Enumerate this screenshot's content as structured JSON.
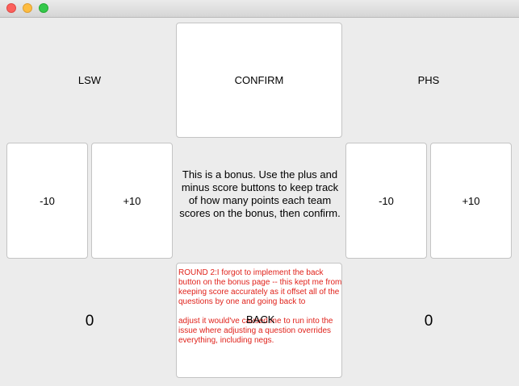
{
  "teams": {
    "left": {
      "name": "LSW",
      "score": "0",
      "minus_label": "-10",
      "plus_label": "+10"
    },
    "right": {
      "name": "PHS",
      "score": "0",
      "minus_label": "-10",
      "plus_label": "+10"
    }
  },
  "confirm_label": "CONFIRM",
  "description": "This is a bonus. Use the plus and minus score buttons to keep track of how many points each team scores on the bonus, then confirm.",
  "back_button": {
    "label": "BACK",
    "note": "ROUND 2:I forgot to implement the back button on the bonus page -- this kept me from keeping score accurately as it offset all of the questions by one and going back to",
    "note_continued": "adjust it would've caused me to run into the issue where adjusting a question overrides everything, including negs."
  },
  "colors": {
    "background": "#ececec",
    "button": "#ffffff",
    "note_text": "#e0221b",
    "close": "#fc605c",
    "minimize": "#fdbc40",
    "maximize": "#34c84a"
  }
}
